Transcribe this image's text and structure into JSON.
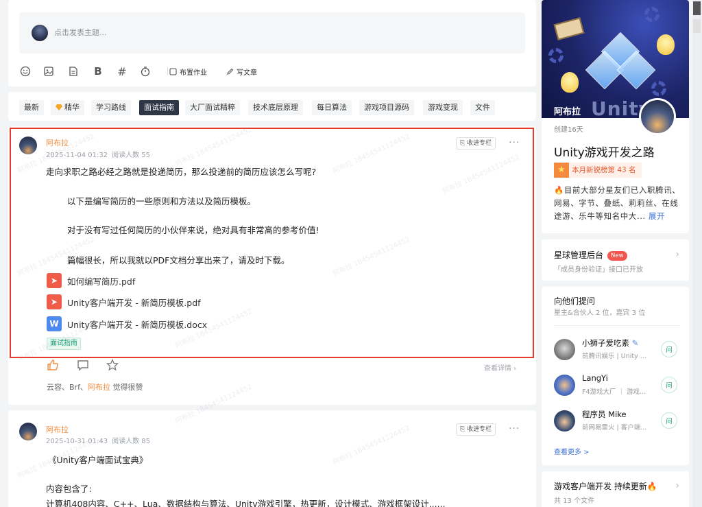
{
  "composer": {
    "placeholder": "点击发表主题...",
    "tools": {
      "emoji": "emoji-icon",
      "image": "image-icon",
      "file": "file-icon",
      "bold": "B",
      "hashtag": "#",
      "timer": "timer-icon",
      "assign_homework": "布置作业",
      "write_article": "写文章"
    }
  },
  "tabs": [
    {
      "label": "最新",
      "active": false
    },
    {
      "label": "精华",
      "active": false
    },
    {
      "label": "学习路线",
      "active": false
    },
    {
      "label": "面试指南",
      "active": true
    },
    {
      "label": "大厂面试精粹",
      "active": false
    },
    {
      "label": "技术底层原理",
      "active": false
    },
    {
      "label": "每日算法",
      "active": false
    },
    {
      "label": "游戏项目源码",
      "active": false
    },
    {
      "label": "游戏变现",
      "active": false
    },
    {
      "label": "文件",
      "active": false
    }
  ],
  "watermark": "阿布拉 18454541124452",
  "post1": {
    "author": "阿布拉",
    "date": "2025-11-04 01:32",
    "reads": "阅读人数 55",
    "collect_button": "收进专栏",
    "more": "···",
    "paragraphs": [
      "走向求职之路必经之路就是投递简历，那么投递前的简历应该怎么写呢?",
      "以下是编写简历的一些原则和方法以及简历模板。",
      "对于没有写过任何简历的小伙伴来说，绝对具有非常高的参考价值!",
      "篇幅很长，所以我就以PDF文档分享出来了，请及时下载。"
    ],
    "files": [
      {
        "name": "如何编写简历.pdf",
        "type": "pdf"
      },
      {
        "name": "Unity客户端开发 - 新简历模板.pdf",
        "type": "pdf"
      },
      {
        "name": "Unity客户端开发 - 新简历模板.docx",
        "type": "docx"
      }
    ],
    "tag": "面试指南",
    "detail_link": "查看详情 ›",
    "likes_prefix": "云容、Brf、",
    "likes_highlight": "阿布拉",
    "likes_suffix": " 觉得很赞"
  },
  "post2": {
    "author": "阿布拉",
    "date": "2025-10-31 01:43",
    "reads": "阅读人数 85",
    "collect_button": "收进专栏",
    "more": "···",
    "paragraphs": [
      "《Unity客户端面试宝典》",
      "内容包含了:",
      "计算机408内容、C++、Lua、数据结构与算法、Unity游戏引擎，热更新，设计模式、游戏框架设计......"
    ]
  },
  "group": {
    "owner": "阿布拉",
    "banner_word": "Unity",
    "created": "创建16天",
    "title": "Unity游戏开发之路",
    "rank_badge": "本月新锐榜第 43 名",
    "description": "🔥目前大部分星友们已入职腾讯、网易、字节、叠纸、莉莉丝、在线途游、乐牛等知名中大...",
    "expand": "展开"
  },
  "admin": {
    "title": "星球管理后台",
    "badge": "New",
    "subtitle": "「成员身份验证」接口已开放"
  },
  "ask": {
    "title": "向他们提问",
    "subtitle": "星主&合伙人 2 位，嘉宾 3 位",
    "ask_label": "问",
    "people": [
      {
        "name": "小狮子爱吃素",
        "desc": "前腾讯娱乐 | Unity ..."
      },
      {
        "name": "LangYi",
        "desc": "F4游戏大厂 ｜ 游戏..."
      },
      {
        "name": "程序员 Mike",
        "desc": "前网易雷火 | 客户端..."
      }
    ],
    "see_more": "查看更多 >"
  },
  "update": {
    "title": "游戏客户端开发 持续更新🔥",
    "subtitle": "共 13 个文件"
  },
  "colors": {
    "accent": "#f08b3c",
    "highlight_border": "#e8392d",
    "active_tab": "#2f3747",
    "tag_green": "#1aa37a",
    "link_blue": "#3d6fd9"
  }
}
